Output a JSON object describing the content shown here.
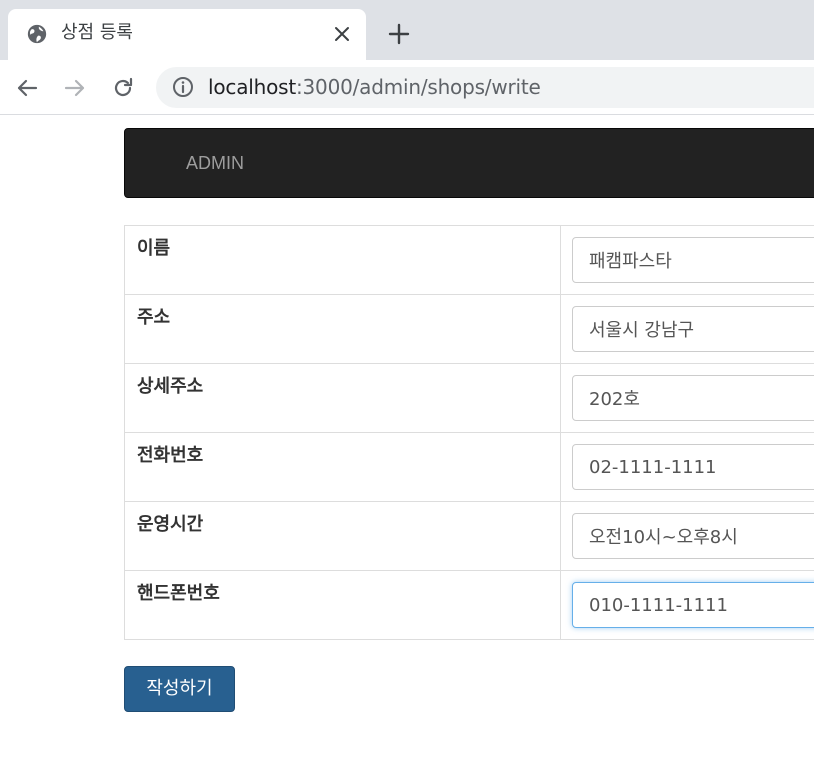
{
  "browser": {
    "tab_title": "상점 등록",
    "url_host": "localhost",
    "url_path": ":3000/admin/shops/write"
  },
  "navbar": {
    "brand": "ADMIN"
  },
  "form": {
    "fields": [
      {
        "label": "이름",
        "value": "패캠파스타"
      },
      {
        "label": "주소",
        "value": "서울시 강남구"
      },
      {
        "label": "상세주소",
        "value": "202호"
      },
      {
        "label": "전화번호",
        "value": "02-1111-1111"
      },
      {
        "label": "운영시간",
        "value": "오전10시~오후8시"
      },
      {
        "label": "핸드폰번호",
        "value": "010-1111-1111"
      }
    ],
    "submit_label": "작성하기"
  },
  "colors": {
    "navbar_bg": "#222222",
    "submit_bg": "#286090",
    "focus_border": "#66afe9"
  }
}
